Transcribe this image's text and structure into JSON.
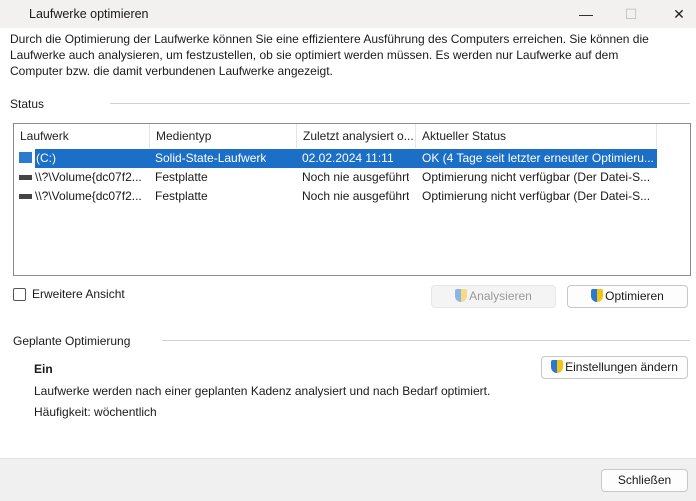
{
  "window": {
    "title": "Laufwerke optimieren",
    "minimize": "—",
    "maximize": "☐",
    "close": "✕"
  },
  "description": [
    "Durch die Optimierung der Laufwerke können Sie eine effizientere Ausführung des Computers erreichen. Sie können die",
    "Laufwerke auch analysieren, um festzustellen, ob sie optimiert werden müssen. Es werden nur Laufwerke auf dem",
    "Computer bzw. die damit verbundenen Laufwerke angezeigt."
  ],
  "status": {
    "label": "Status",
    "columns": [
      "Laufwerk",
      "Medientyp",
      "Zuletzt analysiert o...",
      "Aktueller Status"
    ],
    "rows": [
      {
        "drive": "(C:)",
        "media": "Solid-State-Laufwerk",
        "last": "02.02.2024 11:11",
        "status": "OK (4 Tage seit letzter erneuter Optimieru...",
        "selected": true
      },
      {
        "drive": "\\\\?\\Volume{dc07f2...",
        "media": "Festplatte",
        "last": "Noch nie ausgeführt",
        "status": "Optimierung nicht verfügbar (Der Datei-S..."
      },
      {
        "drive": "\\\\?\\Volume{dc07f2...",
        "media": "Festplatte",
        "last": "Noch nie ausgeführt",
        "status": "Optimierung nicht verfügbar (Der Datei-S..."
      }
    ]
  },
  "advanced_view": {
    "label": "Erweitere Ansicht",
    "checked": false
  },
  "buttons": {
    "analyze": "Analysieren",
    "optimize": "Optimieren",
    "change_settings": "Einstellungen ändern",
    "close": "Schließen"
  },
  "scheduled": {
    "label": "Geplante Optimierung",
    "state": "Ein",
    "description": "Laufwerke werden nach einer geplanten Kadenz analysiert und nach Bedarf optimiert.",
    "frequency": "Häufigkeit: wöchentlich"
  }
}
